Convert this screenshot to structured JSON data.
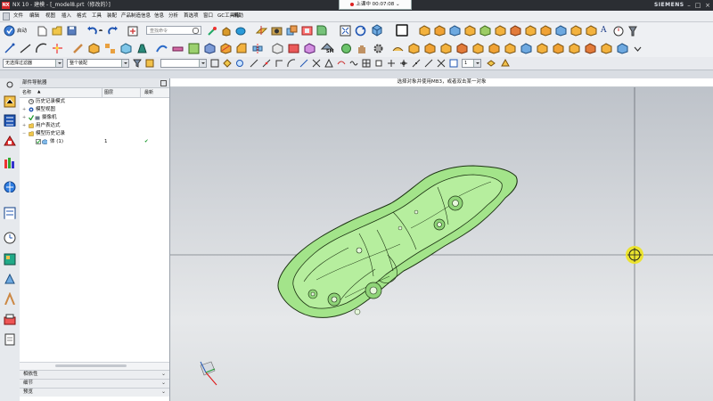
{
  "window": {
    "title": "NX 10 - 建模 - [_model8.prt（修改的）]",
    "brand": "SIEMENS",
    "app_badge": "NX",
    "minimize": "–",
    "maximize": "□",
    "close": "×"
  },
  "recording_timer": {
    "label": "上课中 00:07:08",
    "menu": "⌄"
  },
  "menu": {
    "items": [
      "文件",
      "编辑",
      "视图",
      "插入",
      "格式",
      "工具",
      "装配",
      "产品制造信息",
      "信息",
      "分析",
      "首选项",
      "窗口",
      "GC工具箱",
      "帮助"
    ]
  },
  "toolbar": {
    "start_label": "启动",
    "command_search_placeholder": "查找命令",
    "sm_label": "SM",
    "a_label": "A"
  },
  "selection_bar": {
    "type_filter": "无选择过滤器",
    "scope": "整个装配",
    "spinner_value": "1"
  },
  "cue_line": {
    "text": "选择对象并使用MB3，或者双击某一对象"
  },
  "navigator": {
    "title": "部件导航器",
    "columns": {
      "name": "名称",
      "up_to_date": "图层",
      "latest": "最新"
    },
    "rows": [
      {
        "label": "历史记录模式",
        "layer": "",
        "latest": ""
      },
      {
        "label": "模型视图",
        "layer": "",
        "latest": ""
      },
      {
        "label": "摄像机",
        "layer": "",
        "latest": ""
      },
      {
        "label": "用户表达式",
        "layer": "",
        "latest": ""
      },
      {
        "label": "模型历史记录",
        "layer": "",
        "latest": ""
      },
      {
        "label": "体 (1)",
        "layer": "1",
        "latest": "✔"
      }
    ],
    "bottom_sections": [
      "相依性",
      "细节",
      "预览"
    ],
    "sort_arrow": "▲"
  },
  "colors": {
    "part_fill": "#a3e48a",
    "part_edge": "#1c3312",
    "title_bar": "#2b2e33",
    "toolbar_bg": "#eef0f3",
    "cursor_ring": "#ece325"
  }
}
